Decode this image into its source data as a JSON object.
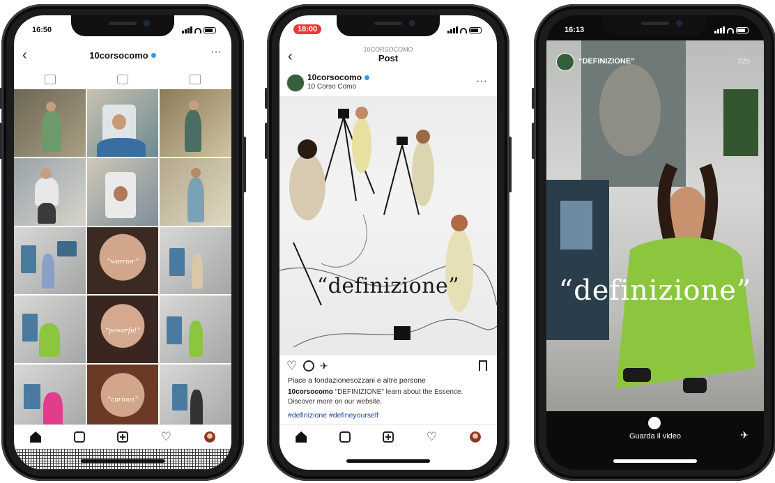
{
  "phone1": {
    "time": "16:50",
    "username": "10corsocomo",
    "grid_overlays": [
      "“warrior”",
      "“powerful”",
      "“curious”"
    ]
  },
  "phone2": {
    "time": "18:00",
    "header_username": "10CORSOCOMO",
    "header_title": "Post",
    "post_username": "10corsocomo",
    "post_location": "10 Corso Como",
    "image_text": "“definizione”",
    "likes_text": "Piace a fondazionesozzani e altre persone",
    "caption_user": "10corsocomo",
    "caption_text": "“DEFINIZIONE” learn about the Essence. Discover more on our website.",
    "hashtags": "#definizione #defineyourself"
  },
  "phone3": {
    "time": "16:13",
    "story_username": "“DEFINIZIONE”",
    "story_time": "22s",
    "story_text": "“definizione”",
    "cta": "Guarda il video"
  },
  "colors": {
    "verified": "#3897f0",
    "hashtag": "#1f3f9a",
    "record_red": "#e53935",
    "dress_green": "#8cc63f"
  }
}
